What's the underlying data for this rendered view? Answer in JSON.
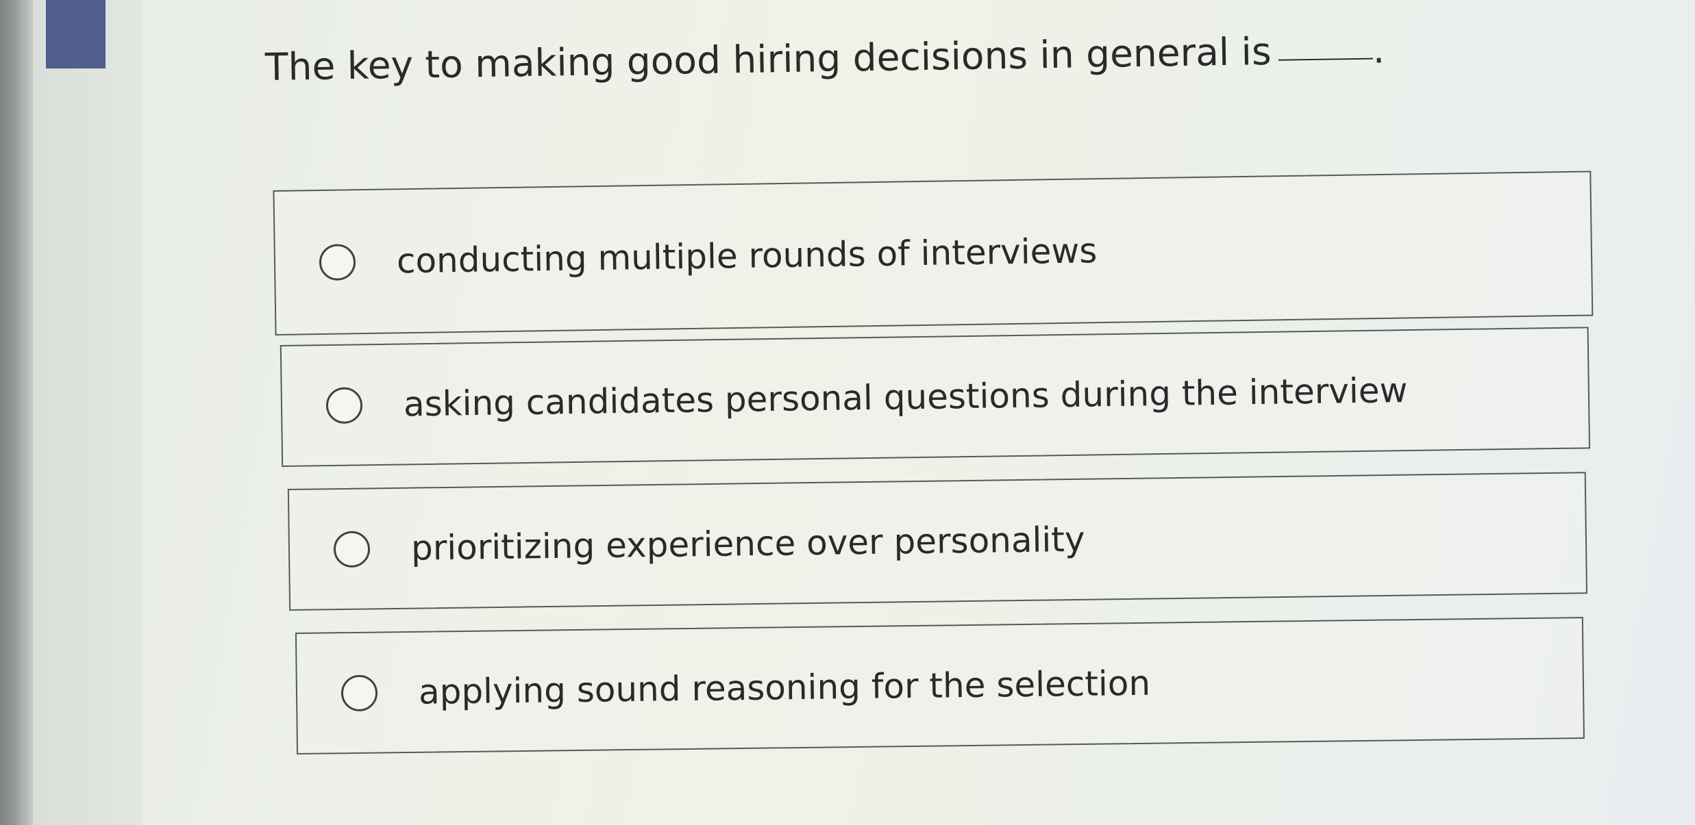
{
  "question": {
    "text": "The key to making good hiring decisions in general is",
    "blank_suffix": "."
  },
  "options": [
    {
      "label": "conducting multiple rounds of interviews",
      "selected": false
    },
    {
      "label": "asking candidates personal questions during the interview",
      "selected": false
    },
    {
      "label": "prioritizing experience over personality",
      "selected": false
    },
    {
      "label": "applying sound reasoning for the selection",
      "selected": false
    }
  ]
}
